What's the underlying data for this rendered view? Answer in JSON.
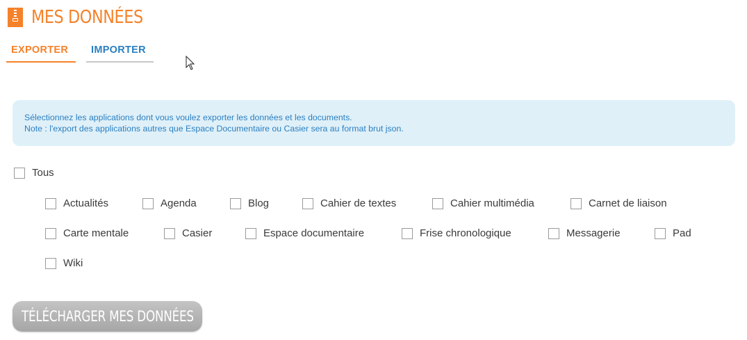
{
  "header": {
    "title": "MES DONNÉES",
    "icon": "zip-archive-icon",
    "accent_color": "#f5822a"
  },
  "tabs": [
    {
      "label": "EXPORTER",
      "active": true
    },
    {
      "label": "IMPORTER",
      "active": false
    }
  ],
  "info": {
    "line1": "Sélectionnez les applications dont vous voulez exporter les données et les documents.",
    "line2": "Note : l'export des applications autres que Espace Documentaire ou Casier sera au format brut json."
  },
  "select_all": {
    "label": "Tous",
    "checked": false
  },
  "apps": [
    {
      "label": "Actualités",
      "checked": false
    },
    {
      "label": "Agenda",
      "checked": false
    },
    {
      "label": "Blog",
      "checked": false
    },
    {
      "label": "Cahier de textes",
      "checked": false
    },
    {
      "label": "Cahier multimédia",
      "checked": false
    },
    {
      "label": "Carnet de liaison",
      "checked": false
    },
    {
      "label": "Carte mentale",
      "checked": false
    },
    {
      "label": "Casier",
      "checked": false
    },
    {
      "label": "Espace documentaire",
      "checked": false
    },
    {
      "label": "Frise chronologique",
      "checked": false
    },
    {
      "label": "Messagerie",
      "checked": false
    },
    {
      "label": "Pad",
      "checked": false
    },
    {
      "label": "Wiki",
      "checked": false
    }
  ],
  "download_button": {
    "label": "TÉLÉCHARGER MES DONNÉES",
    "enabled": false
  }
}
